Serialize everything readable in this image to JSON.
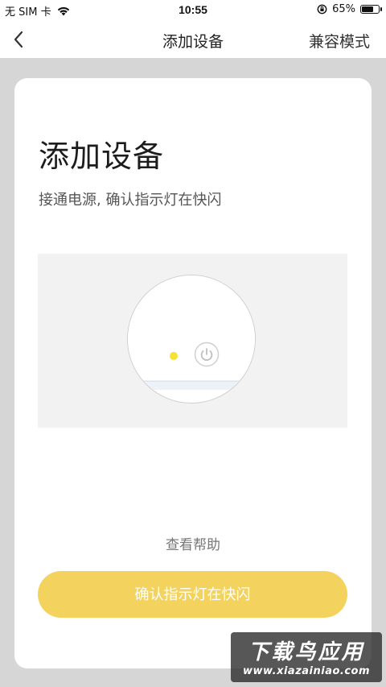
{
  "status_bar": {
    "carrier": "无 SIM 卡",
    "time": "10:55",
    "battery_percent": "65%",
    "battery_level": 0.65,
    "icons": [
      "wifi-icon",
      "orientation-lock-icon",
      "battery-icon"
    ]
  },
  "nav": {
    "back_icon": "chevron-left-icon",
    "title": "添加设备",
    "action": "兼容模式"
  },
  "card": {
    "title": "添加设备",
    "subtitle": "接通电源, 确认指示灯在快闪",
    "illustration": {
      "icons": [
        "indicator-led",
        "power-icon"
      ],
      "led_color": "#f6e232"
    },
    "help_link": "查看帮助",
    "confirm_button": "确认指示灯在快闪",
    "accent_color": "#f3d25e"
  },
  "watermark": {
    "main": "下载鸟应用",
    "sub": "www.xiazainiao.com"
  }
}
